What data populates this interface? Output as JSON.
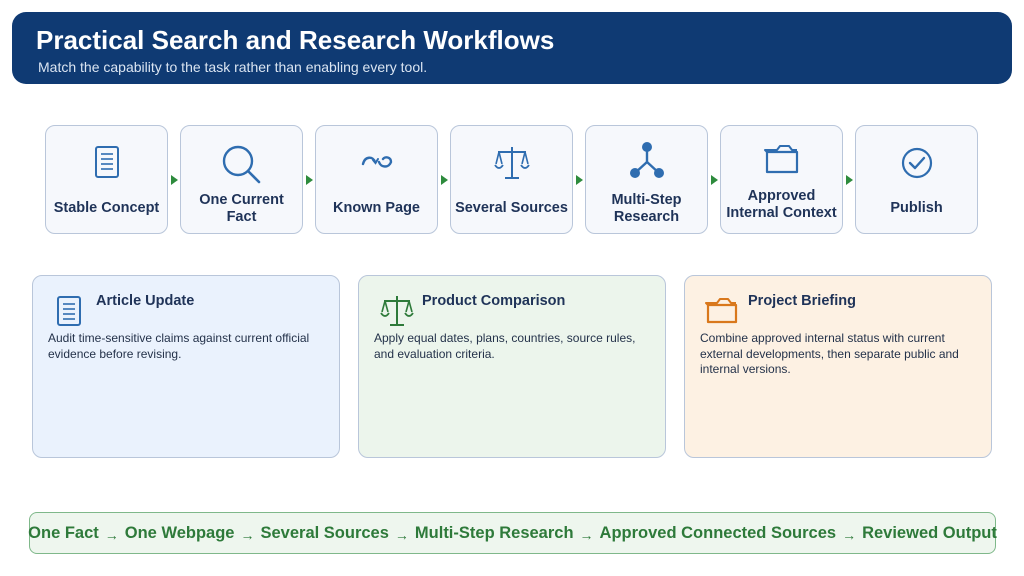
{
  "header": {
    "title": "Practical Search and Research Workflows",
    "subtitle": "Match the capability to the task rather than enabling every tool."
  },
  "steps": [
    {
      "label": "Stable Concept",
      "icon": "document-icon"
    },
    {
      "label": "One Current Fact",
      "icon": "magnifier-icon"
    },
    {
      "label": "Known Page",
      "icon": "link-icon"
    },
    {
      "label": "Several Sources",
      "icon": "scales-icon"
    },
    {
      "label": "Multi-Step Research",
      "icon": "branch-icon"
    },
    {
      "label": "Approved Internal Context",
      "icon": "folder-icon"
    },
    {
      "label": "Publish",
      "icon": "check-circle-icon"
    }
  ],
  "cards": [
    {
      "title": "Article Update",
      "text": "Audit time-sensitive claims against current official evidence before revising.",
      "icon": "document-icon"
    },
    {
      "title": "Product Comparison",
      "text": "Apply equal dates, plans, countries, source rules, and evaluation criteria.",
      "icon": "scales-icon"
    },
    {
      "title": "Project Briefing",
      "text": "Combine approved internal status with current external developments, then separate public and internal versions.",
      "icon": "folder-icon"
    }
  ],
  "footer": {
    "items": [
      "One Fact",
      "One Webpage",
      "Several Sources",
      "Multi-Step Research",
      "Approved Connected Sources",
      "Reviewed Output"
    ],
    "separator": "→"
  },
  "colors": {
    "header_bg": "#0f3a73",
    "icon_blue": "#2f6db0",
    "icon_green": "#2e7a3a",
    "icon_orange": "#d9781c",
    "arrow_green": "#2e8b3d"
  }
}
